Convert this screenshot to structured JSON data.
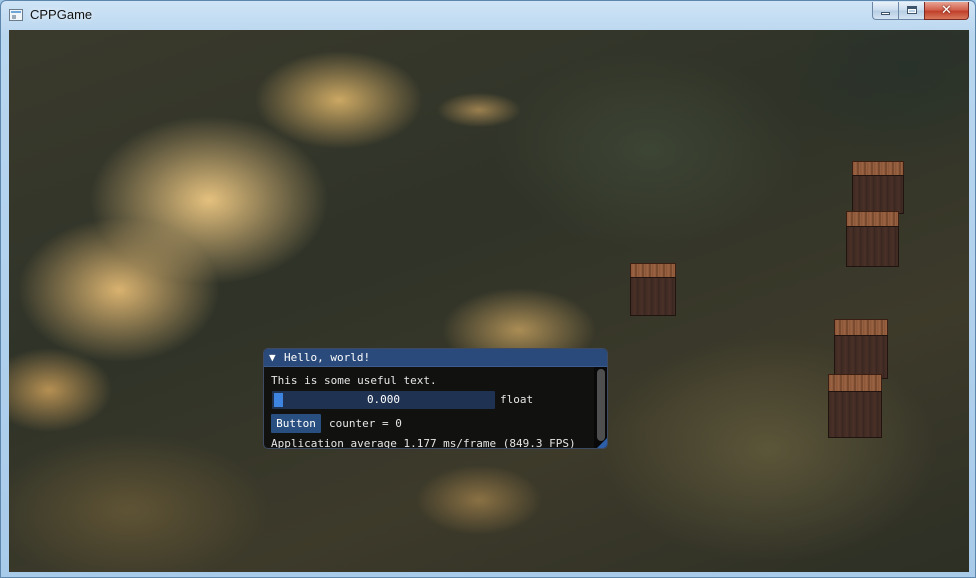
{
  "window": {
    "title": "CPPGame",
    "minimize_symbol": "",
    "maximize_symbol": "",
    "close_symbol": "✕"
  },
  "imgui_window": {
    "collapse_arrow": "▼",
    "title": "Hello, world!",
    "text": "This is some useful text.",
    "slider": {
      "value_text": "0.000",
      "label": "float",
      "value": 0.0
    },
    "button_label": "Button",
    "counter_text": "counter = 0",
    "fps_text": "Application average 1.177 ms/frame (849.3 FPS)"
  },
  "scene": {
    "crate_count": 5,
    "colors": {
      "imgui_title": "#294a7a",
      "imgui_button": "#284f80",
      "slider_grab": "#3d85e0"
    }
  }
}
